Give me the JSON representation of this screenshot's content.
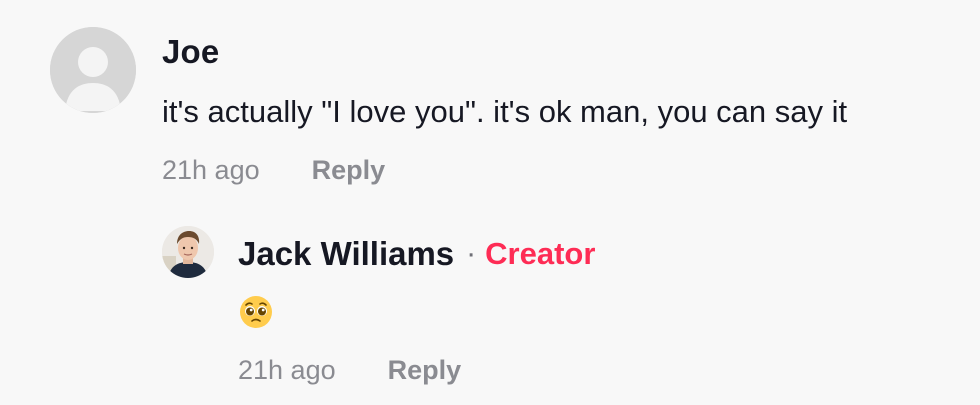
{
  "comment": {
    "author": "Joe",
    "text": "it's actually \"I love you\". it's ok man, you can say it",
    "time": "21h ago",
    "reply_label": "Reply",
    "avatar_icon": "default-user-icon"
  },
  "reply": {
    "author": "Jack Williams",
    "separator": "·",
    "badge": "Creator",
    "text": "🥺",
    "emoji_icon": "pleading-face-emoji",
    "time": "21h ago",
    "reply_label": "Reply"
  },
  "colors": {
    "background": "#f8f8f8",
    "text_primary": "#161823",
    "text_secondary": "#8a8b91",
    "creator_badge": "#fe2c55"
  }
}
